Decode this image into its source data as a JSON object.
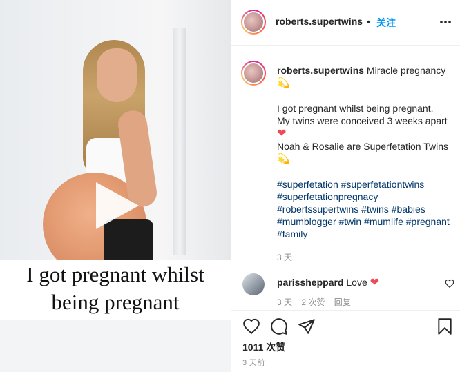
{
  "media": {
    "caption_line1": "I got pregnant whilst",
    "caption_line2": "being pregnant"
  },
  "header": {
    "username": "roberts.supertwins",
    "separator": "•",
    "follow_label": "关注"
  },
  "post": {
    "username": "roberts.supertwins",
    "title": "Miracle pregnancy",
    "body_line1": "I got pregnant whilst being pregnant.",
    "body_line2": "My twins were conceived 3 weeks apart",
    "body_line3": "Noah & Rosalie are Superfetation Twins",
    "hashtags": "#superfetation #superfetationtwins #superfetationpregnacy #robertssupertwins #twins #babies #mumblogger #twin #mumlife #pregnant #family",
    "age": "3 天"
  },
  "comment": {
    "username": "parissheppard",
    "text": "Love",
    "age": "3 天",
    "likes": "2 次赞",
    "reply_label": "回复"
  },
  "footer": {
    "like_count": "1011 次赞",
    "posted_ago": "3 天前"
  },
  "colors": {
    "accent": "#0095f6",
    "hashtag": "#00376b",
    "heart": "#ed4956",
    "muted": "#8e8e8e"
  }
}
